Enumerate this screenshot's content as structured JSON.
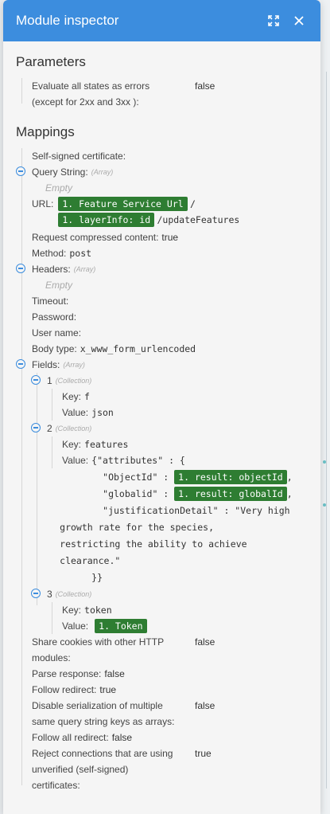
{
  "window": {
    "title": "Module inspector"
  },
  "parameters": {
    "heading": "Parameters",
    "evaluate_label_1": "Evaluate all states as errors",
    "evaluate_label_2": "(except for 2xx and 3xx ):",
    "evaluate_value": "false"
  },
  "mappings": {
    "heading": "Mappings",
    "self_signed_label": "Self-signed certificate:",
    "query_string_label": "Query String:",
    "array_hint": "(Array)",
    "collection_hint": "(Collection)",
    "empty_text": "Empty",
    "url_label": "URL:",
    "url_pill_1": "1. Feature Service Url",
    "url_slash": "/",
    "url_pill_2": "1. layerInfo: id",
    "url_suffix": "/updateFeatures",
    "compressed_label": "Request compressed content:",
    "compressed_value": "true",
    "method_label": "Method:",
    "method_value": "post",
    "headers_label": "Headers:",
    "timeout_label": "Timeout:",
    "password_label": "Password:",
    "username_label": "User name:",
    "body_type_label": "Body type:",
    "body_type_value": "x_www_form_urlencoded",
    "fields_label": "Fields:",
    "key_label": "Key:",
    "value_label": "Value:",
    "items": [
      {
        "index": "1",
        "key": "f",
        "value": "json"
      },
      {
        "index": "2",
        "key": "features",
        "value_line1": "{\"attributes\" : {",
        "objectid_label": "\"ObjectId\" :",
        "objectid_pill": "1. result: objectId",
        "globalid_label": "\"globalid\" :",
        "globalid_pill": "1. result: globalId",
        "comma": ",",
        "justification_1": "\"justificationDetail\" : \"Very high",
        "justification_2": "growth rate for the species,",
        "justification_3": "restricting the ability to achieve",
        "justification_4": "clearance.\"",
        "close": "}}"
      },
      {
        "index": "3",
        "key": "token",
        "value_pill": "1. Token"
      }
    ],
    "share_cookies_1": "Share cookies with other HTTP",
    "share_cookies_2": "modules:",
    "share_cookies_value": "false",
    "parse_label": "Parse response:",
    "parse_value": "false",
    "follow_redirect_label": "Follow redirect:",
    "follow_redirect_value": "true",
    "disable_serial_1": "Disable serialization of multiple",
    "disable_serial_2": "same query string keys as arrays:",
    "disable_serial_value": "false",
    "follow_all_label": "Follow all redirect:",
    "follow_all_value": "false",
    "reject_1": "Reject connections that are using",
    "reject_2": "unverified (self-signed)",
    "reject_3": "certificates:",
    "reject_value": "true"
  },
  "icons": {
    "expand": "expand-icon",
    "close": "close-icon",
    "toggle": "collapse-minus-icon"
  },
  "colors": {
    "titlebar": "#3c8dde",
    "pill": "#2e7d32",
    "toggle": "#3c8dde"
  }
}
